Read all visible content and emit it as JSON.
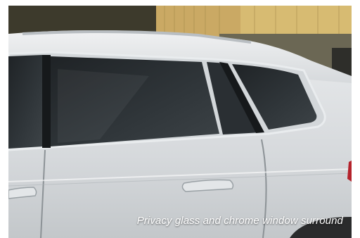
{
  "photo": {
    "subject": "car-side-photo",
    "caption": "Privacy glass and chrome window surround"
  },
  "colors": {
    "body_paint": "#d9dcdf",
    "tinted_glass": "#2b2f33",
    "chrome_trim": "#c9ced2",
    "background_wall": "#c7aa62"
  }
}
